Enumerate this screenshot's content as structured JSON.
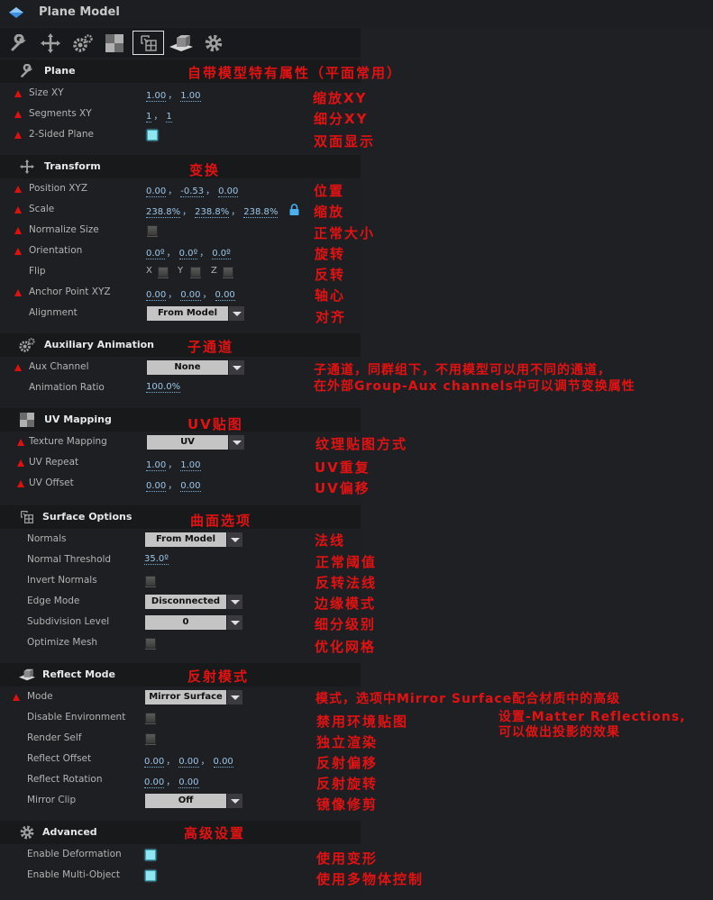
{
  "window": {
    "title": "Plane Model"
  },
  "toolbar": {
    "tabs": [
      {
        "icon": "wrench-icon",
        "active": false
      },
      {
        "icon": "move-icon",
        "active": false
      },
      {
        "icon": "gears-icon",
        "active": false
      },
      {
        "icon": "checker-icon",
        "active": false
      },
      {
        "icon": "surface-icon",
        "active": true
      },
      {
        "icon": "reflect-icon",
        "active": false
      },
      {
        "icon": "gear-icon",
        "active": false
      }
    ]
  },
  "sections": {
    "plane": {
      "title": "Plane",
      "note": "自带模型特有属性（平面常用）",
      "rows": {
        "size": {
          "label": "Size XY",
          "values": [
            "1.00",
            "1.00"
          ],
          "note": "缩放XY"
        },
        "segments": {
          "label": "Segments XY",
          "values": [
            "1",
            "1"
          ],
          "note": "细分XY"
        },
        "two_sided": {
          "label": "2-Sided Plane",
          "checked": true,
          "note": "双面显示"
        }
      }
    },
    "transform": {
      "title": "Transform",
      "note": "变换",
      "rows": {
        "position": {
          "label": "Position XYZ",
          "values": [
            "0.00",
            "-0.53",
            "0.00"
          ],
          "note": "位置"
        },
        "scale": {
          "label": "Scale",
          "values": [
            "238.8%",
            "238.8%",
            "238.8%"
          ],
          "locked": true,
          "note": "缩放"
        },
        "normalize": {
          "label": "Normalize Size",
          "checked": false,
          "note": "正常大小"
        },
        "orientation": {
          "label": "Orientation",
          "values": [
            "0.0º",
            "0.0º",
            "0.0º"
          ],
          "note": "旋转"
        },
        "flip": {
          "label": "Flip",
          "axes": [
            "X",
            "Y",
            "Z"
          ],
          "checked": [
            false,
            false,
            false
          ],
          "note": "反转"
        },
        "anchor": {
          "label": "Anchor Point XYZ",
          "values": [
            "0.00",
            "0.00",
            "0.00"
          ],
          "note": "轴心"
        },
        "alignment": {
          "label": "Alignment",
          "selected": "From Model",
          "note": "对齐"
        }
      }
    },
    "aux": {
      "title": "Auxiliary Animation",
      "note": "子通道",
      "rows": {
        "channel": {
          "label": "Aux Channel",
          "selected": "None",
          "note_line1": "子通道，同群组下，不用模型可以用不同的通道，",
          "note_line2": "在外部Group-Aux channels中可以调节变换属性"
        },
        "ratio": {
          "label": "Animation Ratio",
          "value": "100.0%"
        }
      }
    },
    "uv": {
      "title": "UV Mapping",
      "note": "UV贴图",
      "rows": {
        "texture": {
          "label": "Texture Mapping",
          "selected": "UV",
          "note": "纹理贴图方式"
        },
        "repeat": {
          "label": "UV Repeat",
          "values": [
            "1.00",
            "1.00"
          ],
          "note": "UV重复"
        },
        "offset": {
          "label": "UV Offset",
          "values": [
            "0.00",
            "0.00"
          ],
          "note": "UV偏移"
        }
      }
    },
    "surface": {
      "title": "Surface Options",
      "note": "曲面选项",
      "rows": {
        "normals": {
          "label": "Normals",
          "selected": "From Model",
          "note": "法线"
        },
        "threshold": {
          "label": "Normal Threshold",
          "value": "35.0º",
          "note": "正常阈值"
        },
        "invert": {
          "label": "Invert Normals",
          "checked": false,
          "note": "反转法线"
        },
        "edge": {
          "label": "Edge Mode",
          "selected": "Disconnected",
          "note": "边缘模式"
        },
        "subdiv": {
          "label": "Subdivision Level",
          "selected": "0",
          "note": "细分级别"
        },
        "optimize": {
          "label": "Optimize Mesh",
          "checked": false,
          "note": "优化网格"
        }
      }
    },
    "reflect": {
      "title": "Reflect Mode",
      "note": "反射模式",
      "rows": {
        "mode": {
          "label": "Mode",
          "selected": "Mirror Surface",
          "note": "模式，选项中Mirror Surface配合材质中的高级",
          "note_line2": "设置-Matter Reflections,",
          "note_line3": "可以做出投影的效果"
        },
        "disable_env": {
          "label": "Disable Environment",
          "checked": false,
          "note": "禁用环境贴图"
        },
        "render_self": {
          "label": "Render Self",
          "checked": false,
          "note": "独立渲染"
        },
        "offset": {
          "label": "Reflect Offset",
          "values": [
            "0.00",
            "0.00",
            "0.00"
          ],
          "note": "反射偏移"
        },
        "rotation": {
          "label": "Reflect Rotation",
          "values": [
            "0.00",
            "0.00"
          ],
          "note": "反射旋转"
        },
        "clip": {
          "label": "Mirror Clip",
          "selected": "Off",
          "note": "镜像修剪"
        }
      }
    },
    "advanced": {
      "title": "Advanced",
      "note": "高级设置",
      "rows": {
        "deformation": {
          "label": "Enable Deformation",
          "checked": true,
          "note": "使用变形"
        },
        "multi": {
          "label": "Enable Multi-Object",
          "checked": true,
          "note": "使用多物体控制"
        }
      }
    }
  },
  "separator": "，",
  "colors": {
    "accent_link": "#9cc6e8",
    "note_red": "#e31212",
    "checkbox_on": "#8fe6f0"
  }
}
